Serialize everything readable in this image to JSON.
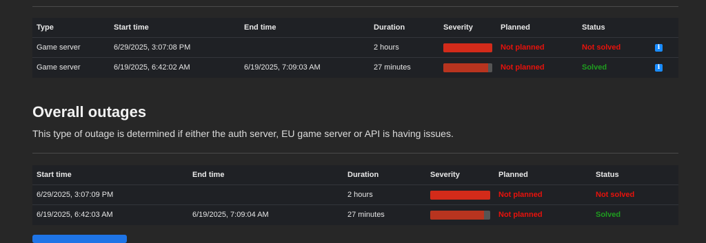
{
  "game_outages": {
    "headers": [
      "Type",
      "Start time",
      "End time",
      "Duration",
      "Severity",
      "Planned",
      "Status"
    ],
    "rows": [
      {
        "type": "Game server",
        "start": "6/29/2025, 3:07:08 PM",
        "end": "",
        "duration": "2 hours",
        "severity": 1.0,
        "planned": "Not planned",
        "status": "Not solved",
        "status_kind": "unsolved"
      },
      {
        "type": "Game server",
        "start": "6/19/2025, 6:42:02 AM",
        "end": "6/19/2025, 7:09:03 AM",
        "duration": "27 minutes",
        "severity": 0.92,
        "planned": "Not planned",
        "status": "Solved",
        "status_kind": "solved"
      }
    ]
  },
  "overall": {
    "title": "Overall outages",
    "description": "This type of outage is determined if either the auth server, EU game server or API is having issues.",
    "headers": [
      "Start time",
      "End time",
      "Duration",
      "Severity",
      "Planned",
      "Status"
    ],
    "rows": [
      {
        "start": "6/29/2025, 3:07:09 PM",
        "end": "",
        "duration": "2 hours",
        "severity": 1.0,
        "planned": "Not planned",
        "status": "Not solved",
        "status_kind": "unsolved"
      },
      {
        "start": "6/19/2025, 6:42:03 AM",
        "end": "6/19/2025, 7:09:04 AM",
        "duration": "27 minutes",
        "severity": 0.9,
        "planned": "Not planned",
        "status": "Solved",
        "status_kind": "solved"
      }
    ]
  },
  "info_icon": "info-icon",
  "colors": {
    "severity_high": "#d32b1a",
    "severity_mid": "#b8341f",
    "not_planned": "#e8120c",
    "solved": "#1f9d1f",
    "info": "#1a8cff"
  }
}
